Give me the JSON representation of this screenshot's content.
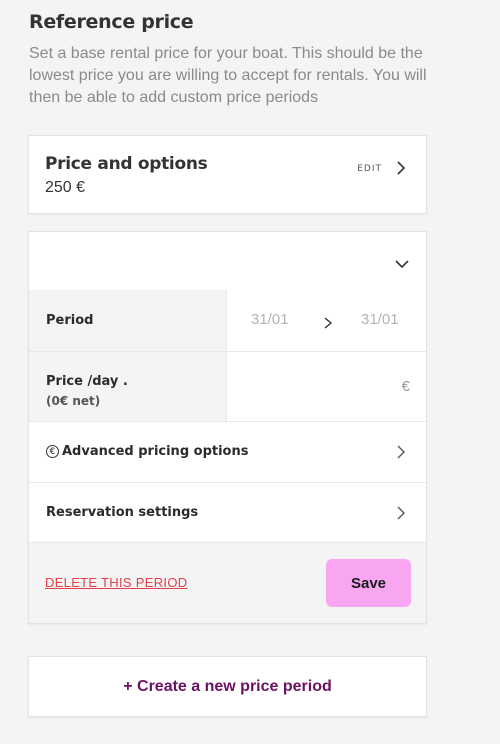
{
  "header": {
    "title": "Reference price",
    "description": "Set a base rental price for your boat. This should be the lowest price you are willing to accept for rentals. You will then be able to add custom price periods"
  },
  "price_card": {
    "heading": "Price and options",
    "amount": "250 €",
    "edit_label": "EDIT",
    "edit_icon": "chevron-right-icon"
  },
  "period_card": {
    "collapse_icon": "chevron-down-icon",
    "period": {
      "label": "Period",
      "start": "31/01",
      "end": "31/01",
      "arrow_icon": "chevron-right-icon"
    },
    "price": {
      "label": "Price /day .",
      "net": "(0€ net)",
      "value": "",
      "currency": "€"
    },
    "advanced": {
      "icon_glyph": "€",
      "icon": "euro-circle-icon",
      "label": "Advanced pricing options"
    },
    "reservation": {
      "label": "Reservation settings"
    },
    "delete_label": "DELETE THIS PERIOD",
    "save_label": "Save"
  },
  "create": {
    "label": "+ Create a new price period"
  },
  "colors": {
    "background": "#f5f4f5",
    "accent_button": "#f9a6f2",
    "delete_link": "#e2404a",
    "create_link": "#6b1262"
  }
}
